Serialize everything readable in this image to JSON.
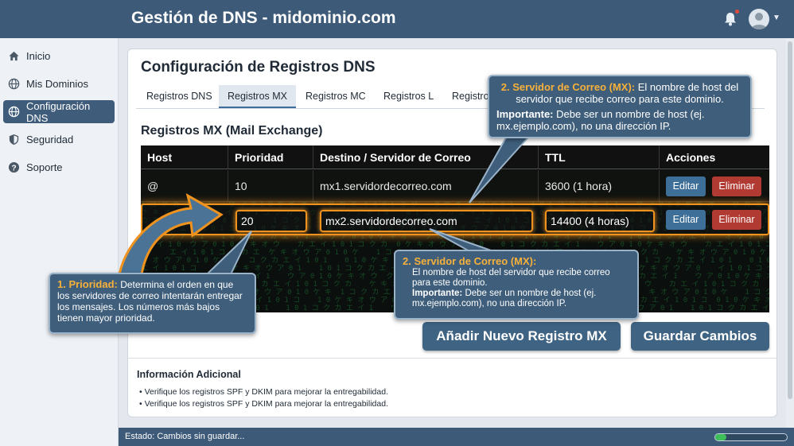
{
  "header": {
    "title": "Gestión de DNS - midominio.com"
  },
  "sidebar": {
    "items": [
      {
        "label": "Inicio",
        "icon": "home-icon"
      },
      {
        "label": "Mis Dominios",
        "icon": "globe-icon"
      },
      {
        "label": "Configuración DNS",
        "icon": "globe-icon",
        "active": true
      },
      {
        "label": "Seguridad",
        "icon": "shield-icon"
      },
      {
        "label": "Soporte",
        "icon": "help-icon"
      }
    ]
  },
  "main": {
    "title": "Configuración de Registros DNS",
    "tabs": [
      "Registros DNS",
      "Registros MX",
      "Registros MC",
      "Registros L",
      "Registro"
    ],
    "active_tab": "Registros MX",
    "section_title": "Registros MX (Mail Exchange)",
    "table": {
      "headers": [
        "Host",
        "Prioridad",
        "Destino / Servidor de Correo",
        "TTL",
        "Acciones"
      ],
      "rows": [
        {
          "host": "@",
          "priority": "10",
          "target": "mx1.servidordecorreo.com",
          "ttl": "3600 (1 hora)",
          "edit": "Editar",
          "delete": "Eliminar"
        },
        {
          "host": "",
          "priority": "20",
          "target": "mx2.servidordecorreo.com",
          "ttl": "14400 (4 horas)",
          "edit": "Editar",
          "delete": "Eliminar"
        }
      ]
    },
    "callout_priority": {
      "label": "1. Prioridad:",
      "text": " Determina el orden en que los servidores de correo intentarán entregar los mensajes. Los números más bajos tienen mayor prioridad."
    },
    "callout_server_top": {
      "label": "2. Servidor de Correo (MX):",
      "text": " El nombre de host del servidor que recibe correo para este dominio.",
      "important_label": "Importante:",
      "important_text": " Debe ser un nombre de host (ej. mx.ejemplo.com), no una dirección IP."
    },
    "callout_server_bottom": {
      "label": "2. Servidor de Correo (MX):",
      "text": "El nombre de host del servidor que recibe correo para este dominio.",
      "important_label": "Importante:",
      "important_text": " Debe ser un nombre de host (ej. mx.ejemplo.com), no una dirección IP."
    },
    "add_button": "Añadir Nuevo Registro MX",
    "save_button": "Guardar Cambios",
    "info": {
      "title": "Información Adicional",
      "items": [
        "Verifique los registros SPF y DKIM para mejorar la entregabilidad.",
        "Verifique los registros SPF y DKIM para mejorar la entregabilidad."
      ]
    }
  },
  "status": {
    "text": "Estado: Cambios sin guardar...",
    "progress_percent": 15
  },
  "colors": {
    "header": "#3d5a78",
    "accent_orange": "#f0931e",
    "callout_highlight": "#f7b13a"
  }
}
